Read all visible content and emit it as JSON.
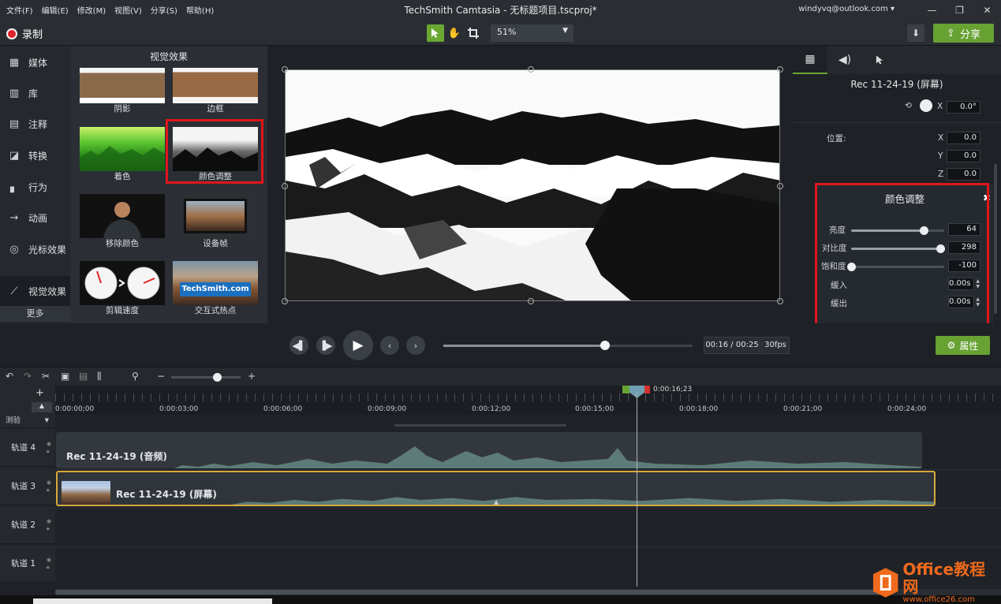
{
  "titlebar": {
    "menus": [
      "文件(F)",
      "编辑(E)",
      "修改(M)",
      "视图(V)",
      "分享(S)",
      "帮助(H)"
    ],
    "title": "TechSmith Camtasia - 无标题项目.tscproj*",
    "account": "windyvq@outlook.com ▾",
    "controls": [
      "—",
      "❐",
      "✕"
    ]
  },
  "toolbar": {
    "record_label": "录制",
    "zoom": "51%",
    "share_label": "分享"
  },
  "sidebar": {
    "items": [
      {
        "label": "媒体",
        "icon": "film-icon"
      },
      {
        "label": "库",
        "icon": "library-icon"
      },
      {
        "label": "注释",
        "icon": "annotation-icon"
      },
      {
        "label": "转换",
        "icon": "transition-icon"
      },
      {
        "label": "行为",
        "icon": "behavior-icon"
      },
      {
        "label": "动画",
        "icon": "animation-icon"
      },
      {
        "label": "光标效果",
        "icon": "cursor-effect-icon"
      },
      {
        "label": "视觉效果",
        "icon": "magic-wand-icon"
      }
    ],
    "more": "更多"
  },
  "bin": {
    "title": "视觉效果",
    "effects": [
      "阴影",
      "边框",
      "着色",
      "颜色调整",
      "移除颜色",
      "设备帧",
      "剪辑速度",
      "交互式热点"
    ],
    "hotspot_text": "TechSmith.com"
  },
  "properties": {
    "clip_title": "Rec 11-24-19 (屏幕)",
    "rotation_label": "X",
    "rotation_value": "0.0°",
    "position_label": "位置:",
    "pos_x_label": "X",
    "pos_x": "0.0",
    "pos_y_label": "Y",
    "pos_y": "0.0",
    "pos_z_label": "Z",
    "pos_z": "0.0",
    "color_adjust": {
      "title": "颜色调整",
      "brightness_label": "亮度",
      "brightness": "64",
      "brightness_level": 0.78,
      "contrast_label": "对比度",
      "contrast": "298",
      "contrast_level": 0.96,
      "saturation_label": "饱和度",
      "saturation": "-100",
      "saturation_level": 0.0,
      "ease_in_label": "缓入",
      "ease_in": "0.00s",
      "ease_out_label": "缓出",
      "ease_out": "0.00s"
    },
    "attr_button": "属性"
  },
  "playback": {
    "time": "00:16 / 00:25",
    "fps": "30fps",
    "progress": 0.65
  },
  "timeline": {
    "ruler_labels": [
      "0:00:00;00",
      "0:00:03;00",
      "0:00:06;00",
      "0:00:09;00",
      "0:00:12;00",
      "0:00:15;00",
      "0:00:18;00",
      "0:00:21;00",
      "0:00:24;00"
    ],
    "playhead_time": "0:00:16;23",
    "tracks": [
      "轨道 4",
      "轨道 3",
      "轨道 2",
      "轨道 1"
    ],
    "audio_clip": "Rec 11-24-19 (音频)",
    "screen_clip": "Rec 11-24-19 (屏幕)",
    "marker_label": "测验"
  },
  "watermark": {
    "line1": "Office教程网",
    "line2": "www.office26.com"
  },
  "colors": {
    "accent": "#67a233",
    "highlight": "#e0161a",
    "clip_border": "#d7a83b"
  }
}
